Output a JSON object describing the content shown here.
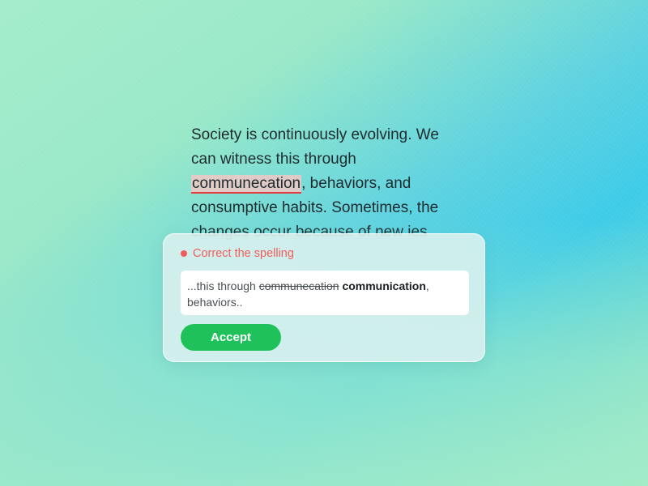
{
  "document": {
    "text_before": "Society is continuously evolving. We can witness this through ",
    "misspelled_word": "communecation",
    "text_after": ", behaviors, and consumptive habits. Sometimes, the changes occur because of new ies"
  },
  "popup": {
    "title": "Correct the spelling",
    "title_color": "#f25c5c",
    "suggestion": {
      "prefix": "...this through ",
      "wrong": "communecation",
      "correct": "communication",
      "suffix": ", behaviors.."
    },
    "accept_label": "Accept",
    "accept_color": "#1fc25a"
  }
}
